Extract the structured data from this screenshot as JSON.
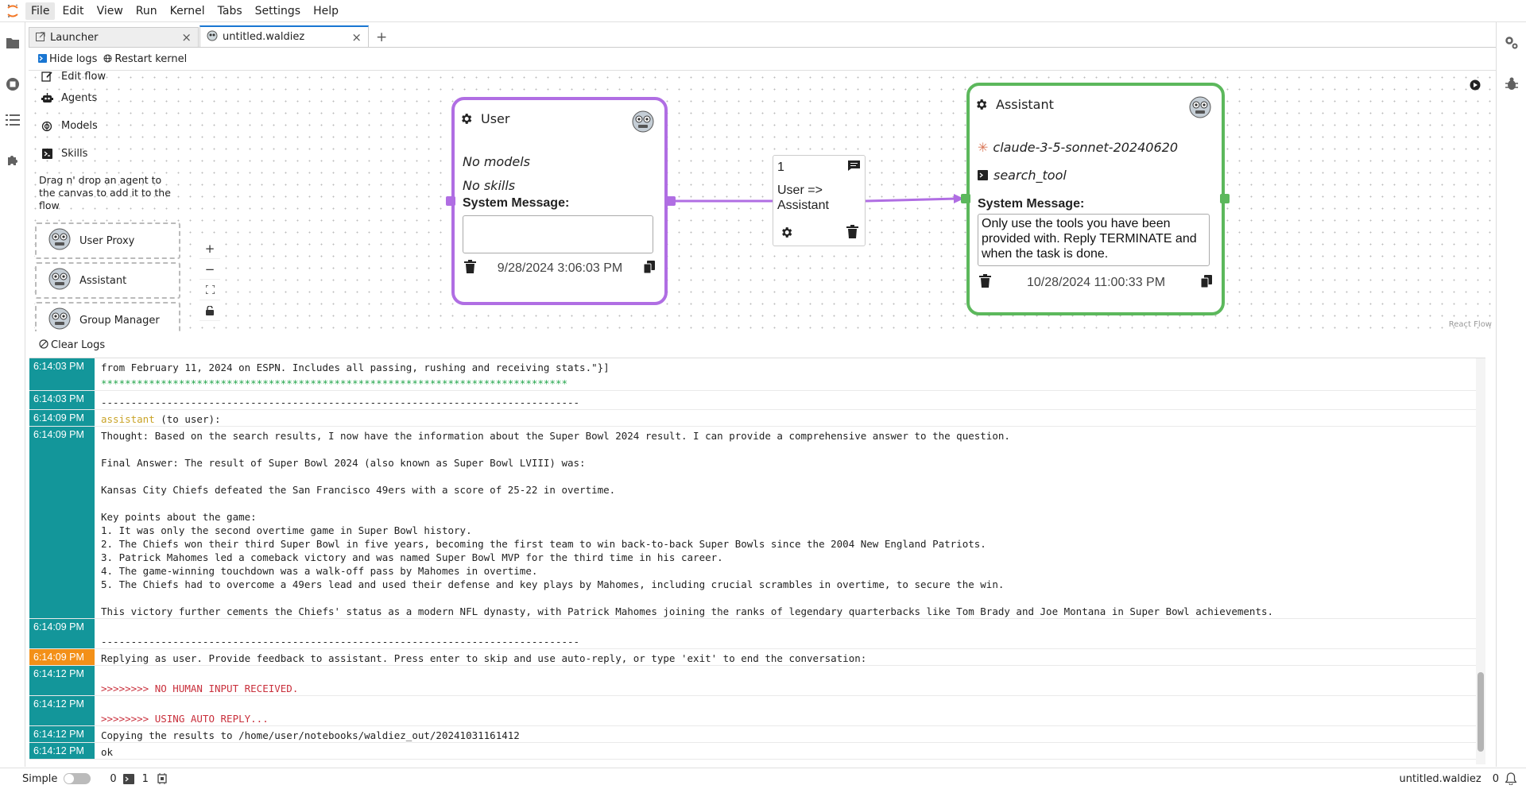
{
  "menubar": {
    "items": [
      "File",
      "Edit",
      "View",
      "Run",
      "Kernel",
      "Tabs",
      "Settings",
      "Help"
    ],
    "active": "File"
  },
  "tabs": [
    {
      "label": "Launcher",
      "icon": "launch-icon"
    },
    {
      "label": "untitled.waldiez",
      "icon": "waldiez-icon"
    }
  ],
  "toolbar": {
    "hide_logs": "Hide logs",
    "restart_kernel": "Restart kernel"
  },
  "flow_menu": {
    "items": [
      {
        "label": "Edit flow",
        "icon": "edit-icon"
      },
      {
        "label": "Agents",
        "icon": "robot-icon"
      },
      {
        "label": "Models",
        "icon": "models-icon"
      },
      {
        "label": "Skills",
        "icon": "terminal-icon"
      }
    ],
    "hint": "Drag n' drop an agent to the canvas to add it to the flow",
    "agents": [
      "User Proxy",
      "Assistant",
      "Group Manager"
    ]
  },
  "nodes": {
    "user": {
      "name": "User",
      "models": "No models",
      "skills": "No skills",
      "system_label": "System Message:",
      "system_message": "",
      "date": "9/28/2024 3:06:03 PM"
    },
    "assistant": {
      "name": "Assistant",
      "model": "claude-3-5-sonnet-20240620",
      "skill": "search_tool",
      "system_label": "System Message:",
      "system_message": "Only use the tools you have been provided with. Reply TERMINATE and when the task is done.",
      "date": "10/28/2024 11:00:33 PM"
    }
  },
  "edge": {
    "order": "1",
    "label": "User => Assistant"
  },
  "attribution": "React Flow",
  "log_header": {
    "clear": "Clear Logs"
  },
  "logs": [
    {
      "time": "6:14:03 PM",
      "text": "from February 11, 2024 on ESPN. Includes all passing, rushing and receiving stats.\"}]",
      "style": ""
    },
    {
      "time": "",
      "text": "******************************************************************************",
      "style": "green",
      "continuation": true
    },
    {
      "time": "6:14:03 PM",
      "text": "",
      "style": ""
    },
    {
      "time": "",
      "text": "--------------------------------------------------------------------------------",
      "style": "",
      "continuation": true
    },
    {
      "time": "6:14:09 PM",
      "text": "assistant",
      "suffix": " (to user):",
      "style": "speaker"
    },
    {
      "time": "6:14:09 PM",
      "text": "Thought: Based on the search results, I now have the information about the Super Bowl 2024 result. I can provide a comprehensive answer to the question.\n\nFinal Answer: The result of Super Bowl 2024 (also known as Super Bowl LVIII) was:\n\nKansas City Chiefs defeated the San Francisco 49ers with a score of 25-22 in overtime.\n\nKey points about the game:\n1. It was only the second overtime game in Super Bowl history.\n2. The Chiefs won their third Super Bowl in five years, becoming the first team to win back-to-back Super Bowls since the 2004 New England Patriots.\n3. Patrick Mahomes led a comeback victory and was named Super Bowl MVP for the third time in his career.\n4. The game-winning touchdown was a walk-off pass by Mahomes in overtime.\n5. The Chiefs had to overcome a 49ers lead and used their defense and key plays by Mahomes, including crucial scrambles in overtime, to secure the win.\n\nThis victory further cements the Chiefs' status as a modern NFL dynasty, with Patrick Mahomes joining the ranks of legendary quarterbacks like Tom Brady and Joe Montana in Super Bowl achievements.",
      "style": ""
    },
    {
      "time": "6:14:09 PM",
      "text": "\n--------------------------------------------------------------------------------",
      "style": ""
    },
    {
      "time": "6:14:09 PM",
      "text": "Replying as user. Provide feedback to assistant. Press enter to skip and use auto-reply, or type 'exit' to end the conversation:",
      "style": "",
      "orange": true
    },
    {
      "time": "6:14:12 PM",
      "text": "\n>>>>>>>> NO HUMAN INPUT RECEIVED.",
      "style": "red"
    },
    {
      "time": "6:14:12 PM",
      "text": "\n>>>>>>>> USING AUTO REPLY...",
      "style": "red"
    },
    {
      "time": "6:14:12 PM",
      "text": "Copying the results to /home/user/notebooks/waldiez_out/20241031161412",
      "style": ""
    },
    {
      "time": "6:14:12 PM",
      "text": "ok",
      "style": ""
    }
  ],
  "statusbar": {
    "mode": "Simple",
    "terminals": "0",
    "kernels": "1",
    "filename": "untitled.waldiez",
    "notifications": "0"
  },
  "colors": {
    "user_border": "#b06ee3",
    "assistant_border": "#5cb85c",
    "log_time_bg": "#13969a",
    "log_time_warn": "#f39018",
    "accent": "#1976d2"
  }
}
